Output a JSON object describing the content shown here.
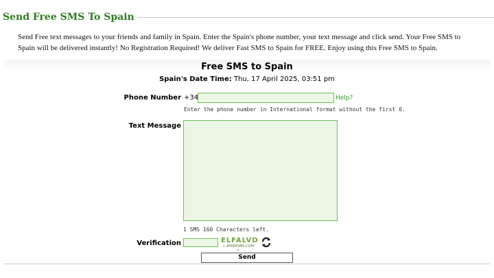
{
  "section": {
    "title": "Send Free SMS To Spain",
    "intro": "Send Free text messages to your friends and family in Spain. Enter the Spain's phone number, your text message and click send. Your Free SMS to Spain will be delivered instantly! No Registration Required! We deliver Fast SMS to Spain for FREE. Enjoy using this Free SMS to Spain."
  },
  "form": {
    "title": "Free SMS to Spain",
    "date_label": "Spain's Date Time:",
    "date_value": "Thu, 17 April 2025, 03:51 pm",
    "phone": {
      "label": "Phone Number",
      "prefix": "+34",
      "value": "",
      "help_label": "Help?",
      "hint": "Enter the phone number in International format without the first 0."
    },
    "message": {
      "label": "Text Message",
      "value": "",
      "counter": "1 SMS 160 Characters left."
    },
    "verification": {
      "label": "Verification",
      "value": "",
      "captcha_text": "ELFALVD",
      "captcha_sub": "< AFREESMS.COM >",
      "refresh_icon": "refresh-icon"
    },
    "send_label": "Send"
  },
  "colors": {
    "title_green": "#2e7d1f",
    "input_bg": "#ecf6e4",
    "input_border": "#6fbf5a",
    "link_green": "#2e9a1f"
  }
}
